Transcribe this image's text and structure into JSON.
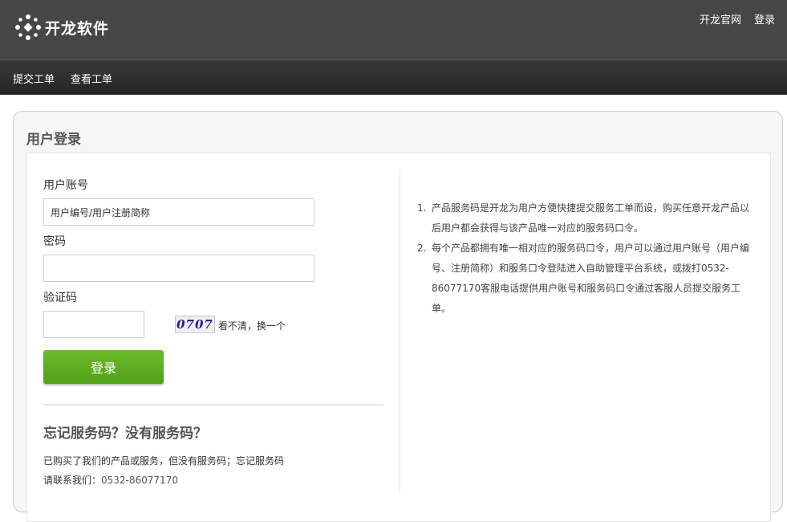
{
  "header": {
    "logo_text": "开龙软件",
    "links": [
      "开龙官网",
      "登录"
    ]
  },
  "nav": {
    "items": [
      "提交工单",
      "查看工单"
    ]
  },
  "login": {
    "title": "用户登录",
    "account_label": "用户账号",
    "account_value": "用户编号/用户注册简称",
    "password_label": "密码",
    "captcha_label": "验证码",
    "captcha_text": "0707",
    "captcha_refresh": "看不清，换一个",
    "submit_label": "登录"
  },
  "forgot": {
    "title": "忘记服务码？没有服务码？",
    "line1": "已购买了我们的产品或服务，但没有服务码；忘记服务码",
    "line2_prefix": "请联系我们：",
    "phone": "0532-86077170"
  },
  "info": {
    "items": [
      {
        "num": "1.",
        "text": "产品服务码是开龙为用户方便快捷提交服务工单而设，购买任意开龙产品以后用户都会获得与该产品唯一对应的服务码口令。"
      },
      {
        "num": "2.",
        "text": "每个产品都拥有唯一相对应的服务码口令，用户可以通过用户账号（用户编号、注册简称）和服务口令登陆进入自助管理平台系统，或拨打0532-86077170客服电话提供用户账号和服务码口令通过客服人员提交服务工单。"
      }
    ]
  },
  "colors": {
    "header_bg": "#464646",
    "button_green": "#5cae22"
  },
  "icons": {
    "logo": "kailong-logo-icon"
  }
}
